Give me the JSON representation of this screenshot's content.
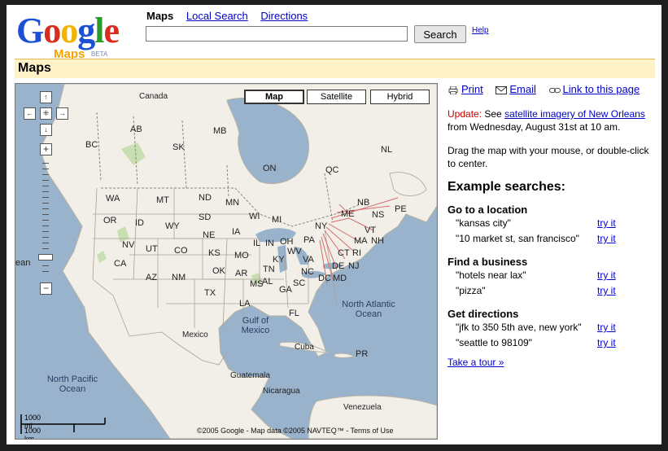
{
  "header": {
    "logo_google": "Google",
    "logo_maps": "Maps",
    "logo_beta": "BETA",
    "nav": [
      {
        "label": "Maps",
        "current": true
      },
      {
        "label": "Local Search",
        "current": false
      },
      {
        "label": "Directions",
        "current": false
      }
    ],
    "search_value": "",
    "search_button": "Search",
    "help": "Help"
  },
  "titlebar": {
    "title": "Maps"
  },
  "map": {
    "type_buttons": [
      "Map",
      "Satellite",
      "Hybrid"
    ],
    "active_type": "Map",
    "pan": {
      "up": "↑",
      "left": "←",
      "center": "⁜",
      "right": "→",
      "down": "↓"
    },
    "zoom_in": "+",
    "zoom_out": "−",
    "labels": {
      "canada": "Canada",
      "ab": "AB",
      "mb": "MB",
      "bc": "BC",
      "sk": "SK",
      "nl": "NL",
      "on": "ON",
      "qc": "QC",
      "wa": "WA",
      "mt": "MT",
      "nd": "ND",
      "mn": "MN",
      "or": "OR",
      "id": "ID",
      "wy": "WY",
      "sd": "SD",
      "wi": "WI",
      "mi": "MI",
      "ny": "NY",
      "me": "ME",
      "nb": "NB",
      "ns": "NS",
      "pe": "PE",
      "vt": "VT",
      "nh": "NH",
      "ma": "MA",
      "ct": "CT",
      "ri": "RI",
      "nj": "NJ",
      "de": "DE",
      "md": "MD",
      "dc": "DC",
      "pa": "PA",
      "oh": "OH",
      "in": "IN",
      "il": "IL",
      "ia": "IA",
      "ne": "NE",
      "nv": "NV",
      "ut": "UT",
      "co": "CO",
      "ks": "KS",
      "mo": "MO",
      "ky": "KY",
      "wv": "WV",
      "va": "VA",
      "ca": "CA",
      "az": "AZ",
      "nm": "NM",
      "ok": "OK",
      "ar": "AR",
      "tn": "TN",
      "nc": "NC",
      "sc": "SC",
      "ms": "MS",
      "al": "AL",
      "ga": "GA",
      "tx": "TX",
      "la": "LA",
      "fl": "FL",
      "ean": "ean",
      "gulf": "Gulf of Mexico",
      "mexico": "Mexico",
      "atlantic": "North Atlantic Ocean",
      "cuba": "Cuba",
      "pr": "PR",
      "guatemala": "Guatemala",
      "nicaragua": "Nicaragua",
      "venezuela": "Venezuela",
      "pacific": "North Pacific Ocean"
    },
    "scale_mi": "1000 mi",
    "scale_km": "1000 km",
    "copyright": "©2005 Google - Map data ©2005 NAVTEQ™ - Terms of Use"
  },
  "side": {
    "tools": {
      "print": "Print",
      "email": "Email",
      "link": "Link to this page"
    },
    "update": {
      "label": "Update:",
      "pre": "See",
      "link": "satellite imagery of New Orleans",
      "post": "from Wednesday, August 31st at 10 am."
    },
    "drag_text": "Drag the map with your mouse, or double-click to center.",
    "examples_heading": "Example searches:",
    "groups": [
      {
        "heading": "Go to a location",
        "items": [
          {
            "query": "\"kansas city\"",
            "try": "try it"
          },
          {
            "query": "\"10 market st, san francisco\"",
            "try": "try it"
          }
        ]
      },
      {
        "heading": "Find a business",
        "items": [
          {
            "query": "\"hotels near lax\"",
            "try": "try it"
          },
          {
            "query": "\"pizza\"",
            "try": "try it"
          }
        ]
      },
      {
        "heading": "Get directions",
        "items": [
          {
            "query": "\"jfk to 350 5th ave, new york\"",
            "try": "try it"
          },
          {
            "query": "\"seattle to 98109\"",
            "try": "try it"
          }
        ]
      }
    ],
    "tour": "Take a tour »"
  },
  "colors": {
    "water": "#99b3cc",
    "land": "#f2efe9",
    "header_bar": "#fff1c8",
    "link": "#0000cc",
    "update_red": "#cc0000"
  }
}
